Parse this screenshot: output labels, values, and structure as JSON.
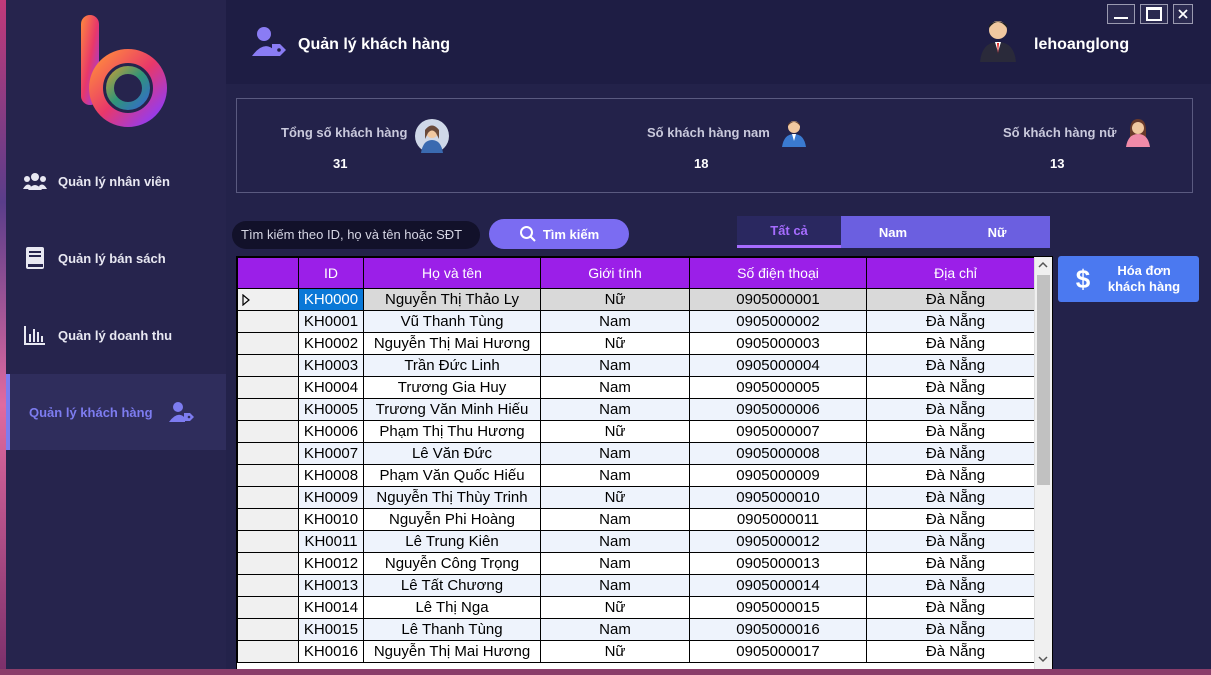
{
  "sidebar": {
    "items": [
      {
        "label": "Quản lý nhân viên",
        "icon": "users-icon"
      },
      {
        "label": "Quản lý bán sách",
        "icon": "book-icon"
      },
      {
        "label": "Quản lý doanh thu",
        "icon": "bar-chart-icon"
      },
      {
        "label": "Quản lý khách hàng",
        "icon": "user-tag-icon",
        "active": true
      }
    ]
  },
  "header": {
    "title": "Quản lý khách hàng",
    "user_name": "lehoanglong"
  },
  "stats": [
    {
      "label": "Tổng số khách hàng",
      "value": "31"
    },
    {
      "label": "Số khách hàng nam",
      "value": "18"
    },
    {
      "label": "Số khách hàng nữ",
      "value": "13"
    }
  ],
  "search": {
    "placeholder": "Tìm kiếm theo ID, họ và tên hoặc SĐT",
    "button_label": "Tìm kiếm"
  },
  "filter_tabs": [
    {
      "label": "Tất cả",
      "active": true
    },
    {
      "label": "Nam"
    },
    {
      "label": "Nữ"
    }
  ],
  "invoice_button": {
    "line1": "Hóa đơn",
    "line2": "khách hàng"
  },
  "table": {
    "columns": [
      "ID",
      "Họ và tên",
      "Giới tính",
      "Số điện thoại",
      "Địa chỉ"
    ],
    "rows": [
      [
        "KH0000",
        "Nguyễn Thị Thảo Ly",
        "Nữ",
        "0905000001",
        "Đà Nẵng"
      ],
      [
        "KH0001",
        "Vũ Thanh Tùng",
        "Nam",
        "0905000002",
        "Đà Nẵng"
      ],
      [
        "KH0002",
        "Nguyễn Thị Mai Hương",
        "Nữ",
        "0905000003",
        "Đà Nẵng"
      ],
      [
        "KH0003",
        "Trần Đức Linh",
        "Nam",
        "0905000004",
        "Đà Nẵng"
      ],
      [
        "KH0004",
        "Trương Gia Huy",
        "Nam",
        "0905000005",
        "Đà Nẵng"
      ],
      [
        "KH0005",
        "Trương Văn Minh Hiếu",
        "Nam",
        "0905000006",
        "Đà Nẵng"
      ],
      [
        "KH0006",
        "Phạm Thị Thu Hương",
        "Nữ",
        "0905000007",
        "Đà Nẵng"
      ],
      [
        "KH0007",
        "Lê Văn Đức",
        "Nam",
        "0905000008",
        "Đà Nẵng"
      ],
      [
        "KH0008",
        "Phạm Văn Quốc Hiếu",
        "Nam",
        "0905000009",
        "Đà Nẵng"
      ],
      [
        "KH0009",
        "Nguyễn Thị Thùy Trinh",
        "Nữ",
        "0905000010",
        "Đà Nẵng"
      ],
      [
        "KH0010",
        "Nguyễn Phi Hoàng",
        "Nam",
        "0905000011",
        "Đà Nẵng"
      ],
      [
        "KH0011",
        "Lê Trung Kiên",
        "Nam",
        "0905000012",
        "Đà Nẵng"
      ],
      [
        "KH0012",
        "Nguyễn Công Trọng",
        "Nam",
        "0905000013",
        "Đà Nẵng"
      ],
      [
        "KH0013",
        "Lê Tất Chương",
        "Nam",
        "0905000014",
        "Đà Nẵng"
      ],
      [
        "KH0014",
        "Lê Thị Nga",
        "Nữ",
        "0905000015",
        "Đà Nẵng"
      ],
      [
        "KH0015",
        "Lê Thanh Tùng",
        "Nam",
        "0905000016",
        "Đà Nẵng"
      ],
      [
        "KH0016",
        "Nguyễn Thị Mai Hương",
        "Nữ",
        "0905000017",
        "Đà Nẵng"
      ]
    ]
  },
  "colors": {
    "accent": "#7b6cf2",
    "header": "#9b1fe8",
    "background": "#23224a"
  }
}
